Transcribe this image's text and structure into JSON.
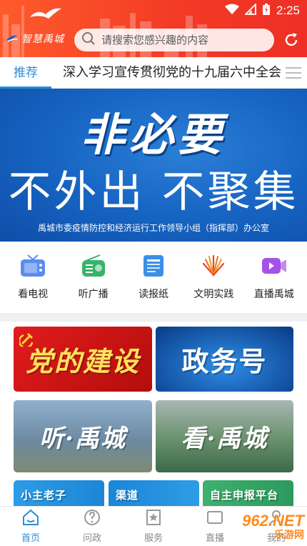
{
  "status_bar": {
    "time": "2:25"
  },
  "header": {
    "logo_text": "智慧禹城",
    "search_placeholder": "请搜索您感兴趣的内容"
  },
  "tabs": {
    "active_label": "推荐",
    "ticker": "深入学习宣传贯彻党的十九届六中全会"
  },
  "banner": {
    "title": "非必要",
    "subtitle": "不外出 不聚集",
    "footer": "禹城市委疫情防控和经济运行工作领导小组（指挥部）办公室"
  },
  "quick_links": [
    {
      "label": "看电视",
      "icon": "tv-icon",
      "color": "#5b8def"
    },
    {
      "label": "听广播",
      "icon": "radio-icon",
      "color": "#35b46b"
    },
    {
      "label": "读报纸",
      "icon": "newspaper-icon",
      "color": "#3d8ee8"
    },
    {
      "label": "文明实践",
      "icon": "fan-icon",
      "color": "#e8452e"
    },
    {
      "label": "直播禹城",
      "icon": "video-camera-icon",
      "color": "#a552e8"
    }
  ],
  "tiles": {
    "party": "党的建设",
    "gov": "政务号",
    "listen": "听·禹城",
    "watch": "看·禹城",
    "row3_a": "小主老子",
    "row3_b": "渠道",
    "row3_c": "自主申报平台"
  },
  "bottom_nav": [
    {
      "label": "首页",
      "icon": "home-icon",
      "active": true
    },
    {
      "label": "问政",
      "icon": "question-icon",
      "active": false
    },
    {
      "label": "服务",
      "icon": "star-bookmark-icon",
      "active": false
    },
    {
      "label": "直播",
      "icon": "live-icon",
      "active": false
    },
    {
      "label": "我的",
      "icon": "user-icon",
      "active": false
    }
  ],
  "watermark": {
    "brand": "962.NET",
    "sub": "乐游网"
  }
}
